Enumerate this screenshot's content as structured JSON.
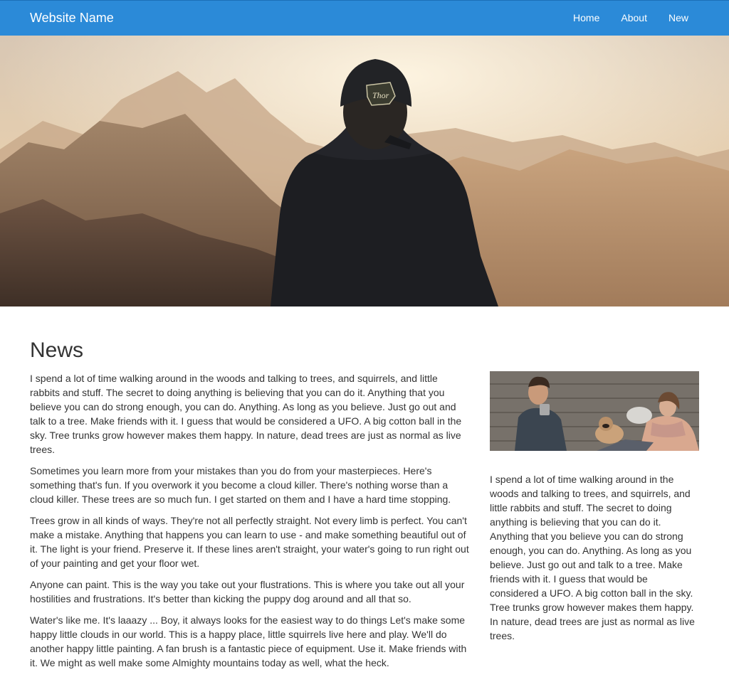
{
  "nav": {
    "brand": "Website Name",
    "links": [
      "Home",
      "About",
      "New"
    ]
  },
  "hero": {
    "image_description": "person in hooded sweatshirt and cap facing sunlit mountain range",
    "cap_logo_text": "Thor"
  },
  "news": {
    "title": "News",
    "paragraphs": [
      "I spend a lot of time walking around in the woods and talking to trees, and squirrels, and little rabbits and stuff. The secret to doing anything is believing that you can do it. Anything that you believe you can do strong enough, you can do. Anything. As long as you believe. Just go out and talk to a tree. Make friends with it. I guess that would be considered a UFO. A big cotton ball in the sky. Tree trunks grow however makes them happy. In nature, dead trees are just as normal as live trees.",
      "Sometimes you learn more from your mistakes than you do from your masterpieces. Here's something that's fun. If you overwork it you become a cloud killer. There's nothing worse than a cloud killer. These trees are so much fun. I get started on them and I have a hard time stopping.",
      "Trees grow in all kinds of ways. They're not all perfectly straight. Not every limb is perfect. You can't make a mistake. Anything that happens you can learn to use - and make something beautiful out of it. The light is your friend. Preserve it. If these lines aren't straight, your water's going to run right out of your painting and get your floor wet.",
      "Anyone can paint. This is the way you take out your flustrations. This is where you take out all your hostilities and frustrations. It's better than kicking the puppy dog around and all that so.",
      "Water's like me. It's laaazy ... Boy, it always looks for the easiest way to do things Let's make some happy little clouds in our world. This is a happy place, little squirrels live here and play. We'll do another happy little painting. A fan brush is a fantastic piece of equipment. Use it. Make friends with it. We might as well make some Almighty mountains today as well, what the heck."
    ]
  },
  "sidebar": {
    "text": "I spend a lot of time walking around in the woods and talking to trees, and squirrels, and little rabbits and stuff. The secret to doing anything is believing that you can do it. Anything that you believe you can do strong enough, you can do. Anything. As long as you believe. Just go out and talk to a tree. Make friends with it. I guess that would be considered a UFO. A big cotton ball in the sky. Tree trunks grow however makes them happy. In nature, dead trees are just as normal as live trees."
  },
  "colors": {
    "navbar": "#2b8ad8",
    "text": "#333333"
  }
}
